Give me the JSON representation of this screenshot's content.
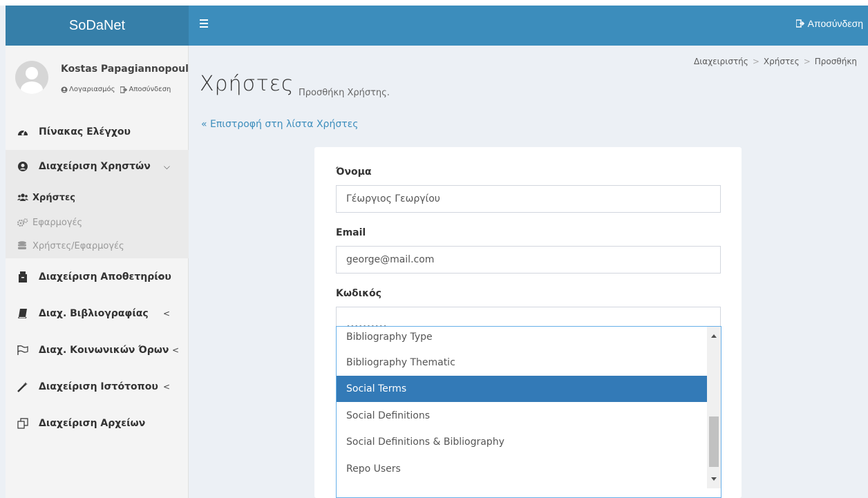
{
  "header": {
    "logo": "SoDaNet",
    "logout": "Αποσύνδεση"
  },
  "user": {
    "name": "Kostas Papagiannopoulo",
    "account": "Λογαριασμός",
    "logout": "Αποσύνδεση"
  },
  "sidebar": {
    "dashboard": "Πίνακας Ελέγχου",
    "user_management": "Διαχείριση Χρηστών",
    "sub_users": "Χρήστες",
    "sub_apps": "Εφαρμογές",
    "sub_user_apps": "Χρήστες/Εφαρμογές",
    "repository": "Διαχείριση Αποθετηρίου",
    "bibliography": "Διαχ. Βιβλιογραφίας",
    "social_terms": "Διαχ. Κοινωνικών Όρων",
    "website": "Διαχείριση Ιστότοπου",
    "files": "Διαχείριση Αρχείων"
  },
  "breadcrumb": {
    "admin": "Διαχειριστής",
    "users": "Χρήστες",
    "add": "Προσθήκη",
    "separator": ">"
  },
  "page": {
    "title": "Χρήστες",
    "subtitle": "Προσθήκη Χρήστης.",
    "back_link": "« Επιστροφή στη λίστα Χρήστες"
  },
  "form": {
    "name_label": "Όνομα",
    "name_value": "Γέωργιος Γεωργίου",
    "email_label": "Email",
    "email_value": "george@mail.com",
    "password_label": "Κωδικός",
    "password_value": "••••••••••"
  },
  "dropdown": {
    "options": [
      "Bibliography Type",
      "Bibliography Thematic",
      "Social Terms",
      "Social Definitions",
      "Social Definitions & Bibliography",
      "Repo Users"
    ],
    "selected_index": 2
  },
  "colors": {
    "header": "#3c8dbc",
    "logo_bg": "#367fa9",
    "selected": "#337ab7",
    "link": "#3c8dbc"
  }
}
